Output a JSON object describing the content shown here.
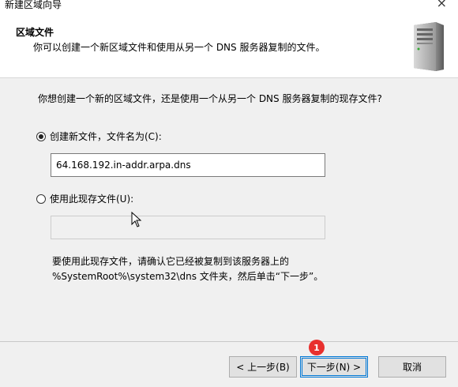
{
  "window": {
    "title": "新建区域向导",
    "close_glyph": "×"
  },
  "header": {
    "title": "区域文件",
    "subtitle": "你可以创建一个新区域文件和使用从另一个 DNS 服务器复制的文件。",
    "icon": "server-icon"
  },
  "main": {
    "question": "你想创建一个新的区域文件，还是使用一个从另一个 DNS 服务器复制的现存文件?",
    "option_create": {
      "label": "创建新文件，文件名为(C):",
      "selected": true,
      "value": "64.168.192.in-addr.arpa.dns"
    },
    "option_existing": {
      "label": "使用此现存文件(U):",
      "selected": false,
      "value": ""
    },
    "note_line1": "要使用此现存文件，请确认它已经被复制到该服务器上的",
    "note_line2": "%SystemRoot%\\system32\\dns 文件夹，然后单击“下一步”。"
  },
  "footer": {
    "back_label": "< 上一步(B)",
    "next_label": "下一步(N) >",
    "cancel_label": "取消",
    "step_badge": "1"
  },
  "colors": {
    "focus": "#0078d7",
    "badge": "#e8302e"
  }
}
